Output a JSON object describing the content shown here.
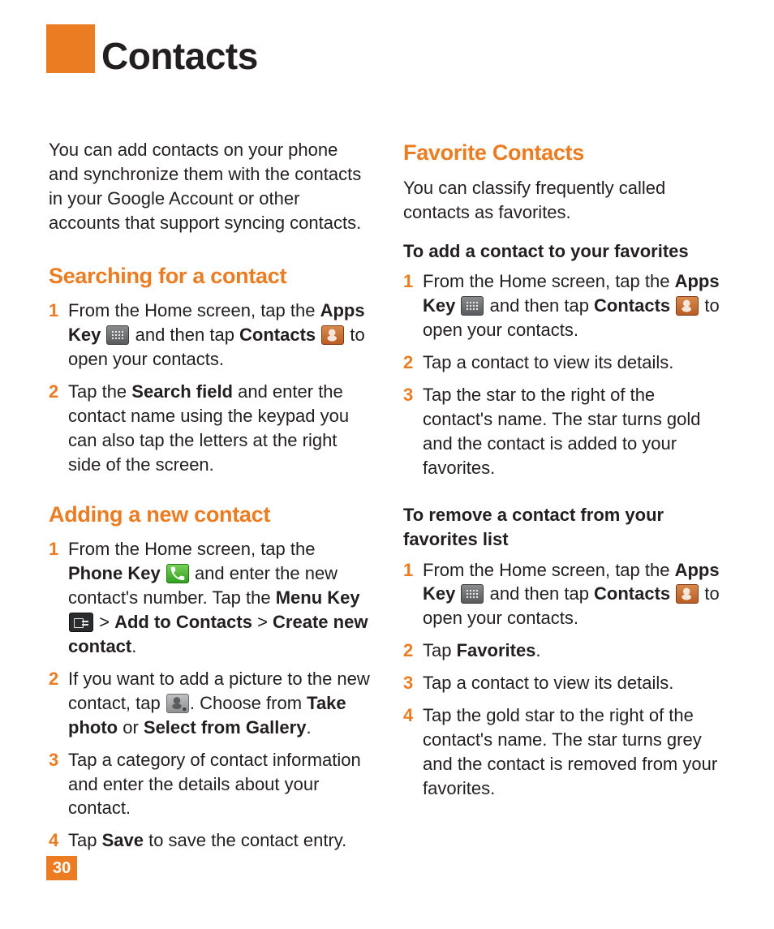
{
  "page_number": "30",
  "title": "Contacts",
  "left": {
    "intro": "You can add contacts on your phone and synchronize them with the contacts in your Google Account or other accounts that support syncing contacts.",
    "sections": [
      {
        "heading": "Searching for a contact",
        "steps": [
          {
            "n": "1",
            "parts": [
              {
                "t": "text",
                "v": "From the Home screen, tap the "
              },
              {
                "t": "bold",
                "v": "Apps Key"
              },
              {
                "t": "text",
                "v": " "
              },
              {
                "t": "icon",
                "v": "apps"
              },
              {
                "t": "text",
                "v": " and then tap "
              },
              {
                "t": "bold",
                "v": "Contacts"
              },
              {
                "t": "text",
                "v": " "
              },
              {
                "t": "icon",
                "v": "contacts"
              },
              {
                "t": "text",
                "v": " to open your contacts."
              }
            ]
          },
          {
            "n": "2",
            "parts": [
              {
                "t": "text",
                "v": "Tap the "
              },
              {
                "t": "bold",
                "v": "Search field"
              },
              {
                "t": "text",
                "v": " and enter the contact name using the keypad you can also tap the letters at the right side of the screen."
              }
            ]
          }
        ]
      },
      {
        "heading": "Adding a new contact",
        "steps": [
          {
            "n": "1",
            "parts": [
              {
                "t": "text",
                "v": "From the Home screen, tap the "
              },
              {
                "t": "bold",
                "v": "Phone Key"
              },
              {
                "t": "text",
                "v": " "
              },
              {
                "t": "icon",
                "v": "phone"
              },
              {
                "t": "text",
                "v": " and enter the new contact's number. Tap the "
              },
              {
                "t": "bold",
                "v": "Menu Key"
              },
              {
                "t": "text",
                "v": " "
              },
              {
                "t": "icon",
                "v": "menu"
              },
              {
                "t": "text",
                "v": " > "
              },
              {
                "t": "bold",
                "v": "Add to Contacts"
              },
              {
                "t": "text",
                "v": " > "
              },
              {
                "t": "bold",
                "v": "Create new contact"
              },
              {
                "t": "text",
                "v": "."
              }
            ]
          },
          {
            "n": "2",
            "parts": [
              {
                "t": "text",
                "v": "If you want to add a picture to the new contact, tap "
              },
              {
                "t": "icon",
                "v": "addphoto"
              },
              {
                "t": "text",
                "v": ". Choose from "
              },
              {
                "t": "bold",
                "v": "Take photo"
              },
              {
                "t": "text",
                "v": " or "
              },
              {
                "t": "bold",
                "v": "Select from Gallery"
              },
              {
                "t": "text",
                "v": "."
              }
            ]
          },
          {
            "n": "3",
            "parts": [
              {
                "t": "text",
                "v": "Tap a category of contact information and enter the details about your contact."
              }
            ]
          },
          {
            "n": "4",
            "parts": [
              {
                "t": "text",
                "v": "Tap "
              },
              {
                "t": "bold",
                "v": "Save"
              },
              {
                "t": "text",
                "v": " to save the contact entry."
              }
            ]
          }
        ]
      }
    ]
  },
  "right": {
    "sections": [
      {
        "heading": "Favorite Contacts",
        "intro": "You can classify frequently called contacts as favorites.",
        "blocks": [
          {
            "subhead": "To add a contact to your favorites",
            "steps": [
              {
                "n": "1",
                "parts": [
                  {
                    "t": "text",
                    "v": "From the Home screen, tap the "
                  },
                  {
                    "t": "bold",
                    "v": "Apps Key"
                  },
                  {
                    "t": "text",
                    "v": " "
                  },
                  {
                    "t": "icon",
                    "v": "apps"
                  },
                  {
                    "t": "text",
                    "v": " and then tap "
                  },
                  {
                    "t": "bold",
                    "v": "Contacts"
                  },
                  {
                    "t": "text",
                    "v": " "
                  },
                  {
                    "t": "icon",
                    "v": "contacts"
                  },
                  {
                    "t": "text",
                    "v": " to open your contacts."
                  }
                ]
              },
              {
                "n": "2",
                "parts": [
                  {
                    "t": "text",
                    "v": "Tap a contact to view its details."
                  }
                ]
              },
              {
                "n": "3",
                "parts": [
                  {
                    "t": "text",
                    "v": "Tap the star to the right of the contact's name. The star turns gold and the contact is added to your favorites."
                  }
                ]
              }
            ]
          },
          {
            "subhead": "To remove a contact from your favorites list",
            "steps": [
              {
                "n": "1",
                "parts": [
                  {
                    "t": "text",
                    "v": "From the Home screen, tap the "
                  },
                  {
                    "t": "bold",
                    "v": "Apps Key"
                  },
                  {
                    "t": "text",
                    "v": " "
                  },
                  {
                    "t": "icon",
                    "v": "apps"
                  },
                  {
                    "t": "text",
                    "v": " and then tap "
                  },
                  {
                    "t": "bold",
                    "v": "Contacts"
                  },
                  {
                    "t": "text",
                    "v": " "
                  },
                  {
                    "t": "icon",
                    "v": "contacts"
                  },
                  {
                    "t": "text",
                    "v": " to open your contacts."
                  }
                ]
              },
              {
                "n": "2",
                "parts": [
                  {
                    "t": "text",
                    "v": "Tap "
                  },
                  {
                    "t": "bold",
                    "v": "Favorites"
                  },
                  {
                    "t": "text",
                    "v": "."
                  }
                ]
              },
              {
                "n": "3",
                "parts": [
                  {
                    "t": "text",
                    "v": "Tap a contact to view its details."
                  }
                ]
              },
              {
                "n": "4",
                "parts": [
                  {
                    "t": "text",
                    "v": "Tap the gold star to the right of the contact's name. The star turns grey and the contact is removed from your favorites."
                  }
                ]
              }
            ]
          }
        ]
      }
    ]
  }
}
